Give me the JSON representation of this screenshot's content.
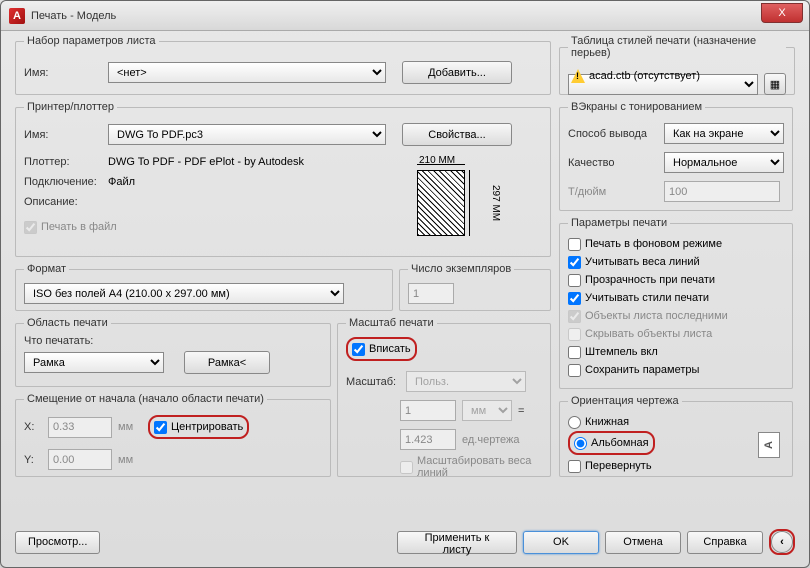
{
  "window": {
    "title": "Печать - Модель",
    "close_x": "X",
    "app_letter": "A"
  },
  "pageSetup": {
    "legend": "Набор параметров листа",
    "name_label": "Имя:",
    "name_value": "<нет>",
    "add_btn": "Добавить..."
  },
  "printer": {
    "legend": "Принтер/плоттер",
    "name_label": "Имя:",
    "name_value": "DWG To PDF.pc3",
    "props_btn": "Свойства...",
    "plotter_label": "Плоттер:",
    "plotter_value": "DWG To PDF - PDF ePlot - by Autodesk",
    "conn_label": "Подключение:",
    "conn_value": "Файл",
    "desc_label": "Описание:",
    "print_to_file": "Печать в файл",
    "paper_w": "210 MM",
    "paper_h": "297 MM"
  },
  "paperSize": {
    "legend": "Формат",
    "value": "ISO без полей A4 (210.00 x 297.00 мм)"
  },
  "copies": {
    "legend": "Число экземпляров",
    "value": "1"
  },
  "plotArea": {
    "legend": "Область печати",
    "what_label": "Что печатать:",
    "value": "Рамка",
    "window_btn": "Рамка<"
  },
  "offset": {
    "legend": "Смещение от начала (начало области печати)",
    "x_label": "X:",
    "x_value": "0.33",
    "x_unit": "мм",
    "y_label": "Y:",
    "y_value": "0.00",
    "y_unit": "мм",
    "center": "Центрировать"
  },
  "scale": {
    "legend": "Масштаб печати",
    "fit": "Вписать",
    "scale_label": "Масштаб:",
    "scale_value": "Польз.",
    "num": "1",
    "unit": "мм",
    "eq": "=",
    "den": "1.423",
    "den_unit": "ед.чертежа",
    "scale_lw": "Масштабировать веса линий"
  },
  "styleTable": {
    "legend": "Таблица стилей печати (назначение перьев)",
    "value": "acad.ctb (отсутствует)"
  },
  "shaded": {
    "legend": "ВЭкраны с тонированием",
    "mode_label": "Способ вывода",
    "mode_value": "Как на экране",
    "quality_label": "Качество",
    "quality_value": "Нормальное",
    "dpi_label": "Т/дюйм",
    "dpi_value": "100"
  },
  "options": {
    "legend": "Параметры печати",
    "bg": "Печать в фоновом режиме",
    "lw": "Учитывать веса линий",
    "tr": "Прозрачность при печати",
    "styles": "Учитывать стили печати",
    "paperspace_last": "Объекты листа последними",
    "hide": "Скрывать объекты листа",
    "stamp": "Штемпель вкл",
    "save": "Сохранить параметры"
  },
  "orientation": {
    "legend": "Ориентация чертежа",
    "portrait": "Книжная",
    "landscape": "Альбомная",
    "upside": "Перевернуть",
    "a": "A"
  },
  "buttons": {
    "preview": "Просмотр...",
    "apply": "Применить к листу",
    "ok": "OK",
    "cancel": "Отмена",
    "help": "Справка",
    "collapse": "‹"
  }
}
